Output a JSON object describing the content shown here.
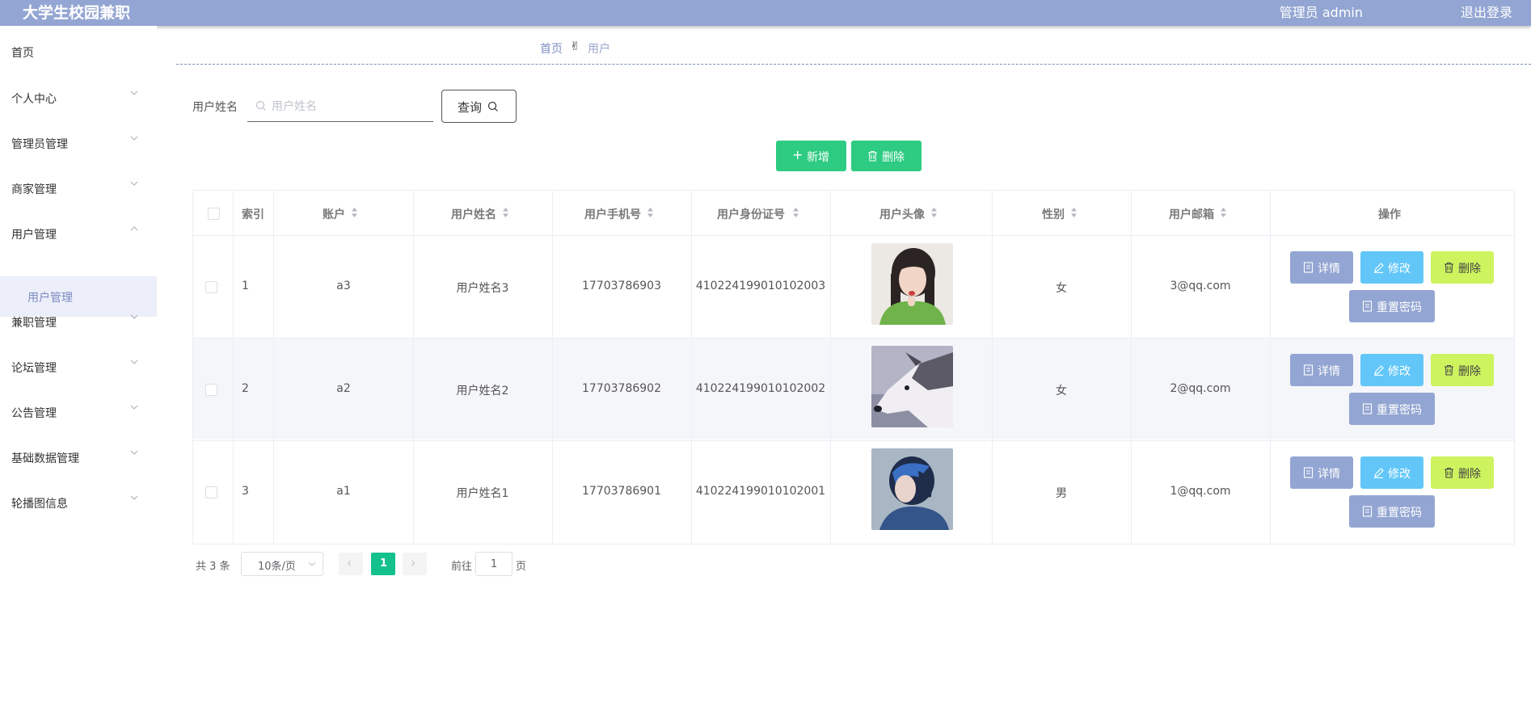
{
  "header": {
    "app_title": "大学生校园兼职",
    "admin_label": "管理员 admin",
    "logout_label": "退出登录",
    "bar_color": "#93a5d2"
  },
  "sidebar": {
    "items": [
      {
        "label": "首页",
        "has_arrow": false
      },
      {
        "label": "个人中心",
        "has_arrow": true
      },
      {
        "label": "管理员管理",
        "has_arrow": true
      },
      {
        "label": "商家管理",
        "has_arrow": true
      },
      {
        "label": "用户管理",
        "has_arrow": true,
        "expanded": true
      },
      {
        "label": "兼职管理",
        "has_arrow": true
      },
      {
        "label": "论坛管理",
        "has_arrow": true
      },
      {
        "label": "公告管理",
        "has_arrow": true
      },
      {
        "label": "基础数据管理",
        "has_arrow": true
      },
      {
        "label": "轮播图信息",
        "has_arrow": true
      }
    ],
    "active_submenu": "用户管理"
  },
  "breadcrumb": {
    "home": "首页",
    "current": "用户"
  },
  "search": {
    "label": "用户姓名",
    "placeholder": "用户姓名",
    "value": "",
    "button_label": "查询"
  },
  "actions": {
    "add_label": "新增",
    "delete_label": "删除",
    "color": "#2ecb82"
  },
  "table": {
    "columns": [
      "索引",
      "账户",
      "用户姓名",
      "用户手机号",
      "用户身份证号",
      "用户头像",
      "性别",
      "用户邮箱",
      "操作"
    ],
    "rows": [
      {
        "index": "1",
        "account": "a3",
        "name": "用户姓名3",
        "phone": "17703786903",
        "id_card": "410224199010102003",
        "avatar": "photo of girl in green sweater",
        "gender": "女",
        "email": "3@qq.com"
      },
      {
        "index": "2",
        "account": "a2",
        "name": "用户姓名2",
        "phone": "17703786902",
        "id_card": "410224199010102002",
        "avatar": "photo of husky dog",
        "gender": "女",
        "email": "2@qq.com"
      },
      {
        "index": "3",
        "account": "a1",
        "name": "用户姓名1",
        "phone": "17703786901",
        "id_card": "410224199010102001",
        "avatar": "illustration of blue-haired boy",
        "gender": "男",
        "email": "1@qq.com"
      }
    ],
    "row_buttons": {
      "detail": "详情",
      "edit": "修改",
      "delete": "删除",
      "reset": "重置密码"
    }
  },
  "pagination": {
    "total_text": "共 3 条",
    "page_size": "10条/页",
    "current_page": "1",
    "goto_label": "前往",
    "goto_value": "1",
    "page_unit": "页"
  }
}
